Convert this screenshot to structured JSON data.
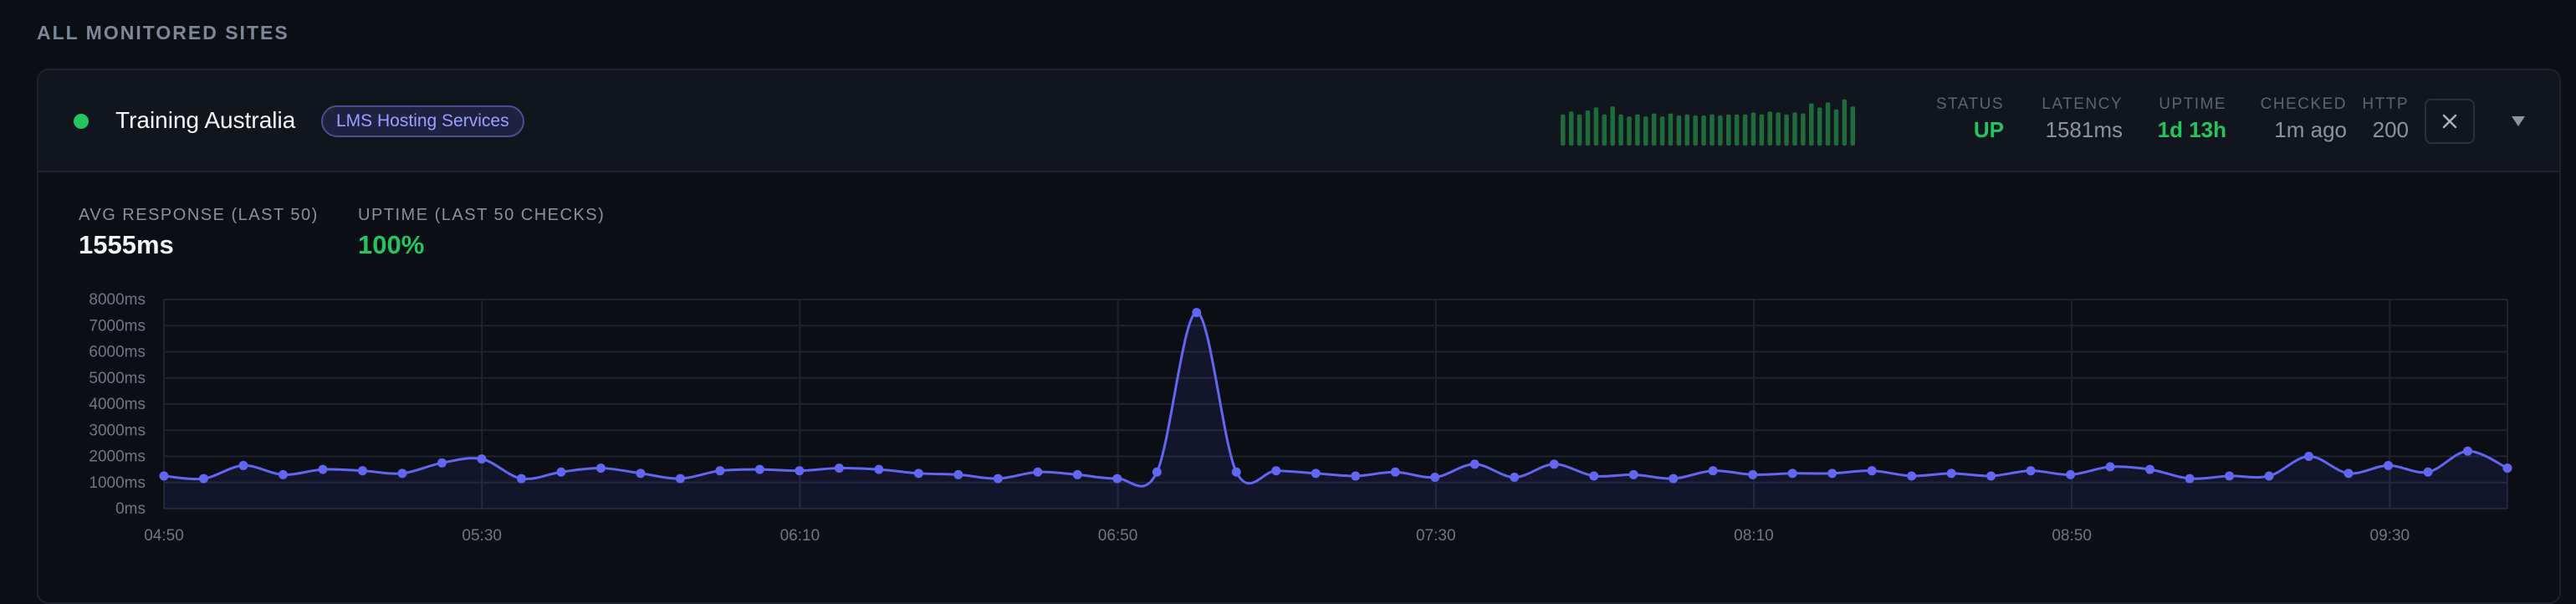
{
  "section": {
    "title": "ALL MONITORED SITES"
  },
  "site": {
    "name": "Training Australia",
    "tag": "LMS Hosting Services",
    "status_color": "#22c55e"
  },
  "header_stats": [
    {
      "label": "STATUS",
      "value": "UP",
      "accent": true
    },
    {
      "label": "LATENCY",
      "value": "1581ms",
      "accent": false
    },
    {
      "label": "UPTIME",
      "value": "1d 13h",
      "accent": true
    },
    {
      "label": "CHECKED",
      "value": "1m ago",
      "accent": false
    },
    {
      "label": "HTTP",
      "value": "200",
      "accent": false
    }
  ],
  "sparkline": {
    "color": "#1f6b3c",
    "values": [
      0.62,
      0.68,
      0.62,
      0.7,
      0.76,
      0.62,
      0.78,
      0.62,
      0.58,
      0.62,
      0.58,
      0.64,
      0.58,
      0.64,
      0.6,
      0.62,
      0.6,
      0.6,
      0.62,
      0.6,
      0.62,
      0.62,
      0.62,
      0.66,
      0.62,
      0.68,
      0.66,
      0.62,
      0.66,
      0.64,
      0.84,
      0.76,
      0.86,
      0.72,
      0.92,
      0.78
    ]
  },
  "icons": {
    "close": "close-icon",
    "chevron": "chevron-down-icon",
    "dot": "status-dot"
  },
  "metrics": {
    "avg_label": "AVG RESPONSE (LAST 50)",
    "avg_value": "1555ms",
    "uptime_label": "UPTIME (LAST 50 CHECKS)",
    "uptime_value": "100%"
  },
  "chart_data": {
    "type": "line",
    "title": "",
    "xlabel": "",
    "ylabel": "",
    "ylim": [
      0,
      8000
    ],
    "y_ticks": [
      "0ms",
      "1000ms",
      "2000ms",
      "3000ms",
      "4000ms",
      "5000ms",
      "6000ms",
      "7000ms",
      "8000ms"
    ],
    "x_ticks": [
      "04:50",
      "05:30",
      "06:10",
      "06:50",
      "07:30",
      "08:10",
      "08:50",
      "09:30"
    ],
    "grid": true,
    "line_color": "#6366f1",
    "series": [
      {
        "name": "",
        "values": [
          1250,
          1150,
          1650,
          1300,
          1500,
          1450,
          1350,
          1750,
          1900,
          1150,
          1400,
          1550,
          1350,
          1150,
          1450,
          1500,
          1450,
          1550,
          1500,
          1350,
          1300,
          1150,
          1400,
          1300,
          1150,
          1400,
          7500,
          1400,
          1450,
          1350,
          1250,
          1400,
          1200,
          1700,
          1200,
          1700,
          1250,
          1300,
          1150,
          1450,
          1300,
          1350,
          1350,
          1450,
          1250,
          1350,
          1250,
          1450,
          1300,
          1600,
          1500,
          1150,
          1250,
          1250,
          2000,
          1350,
          1650,
          1400,
          2200,
          1550
        ]
      }
    ]
  }
}
